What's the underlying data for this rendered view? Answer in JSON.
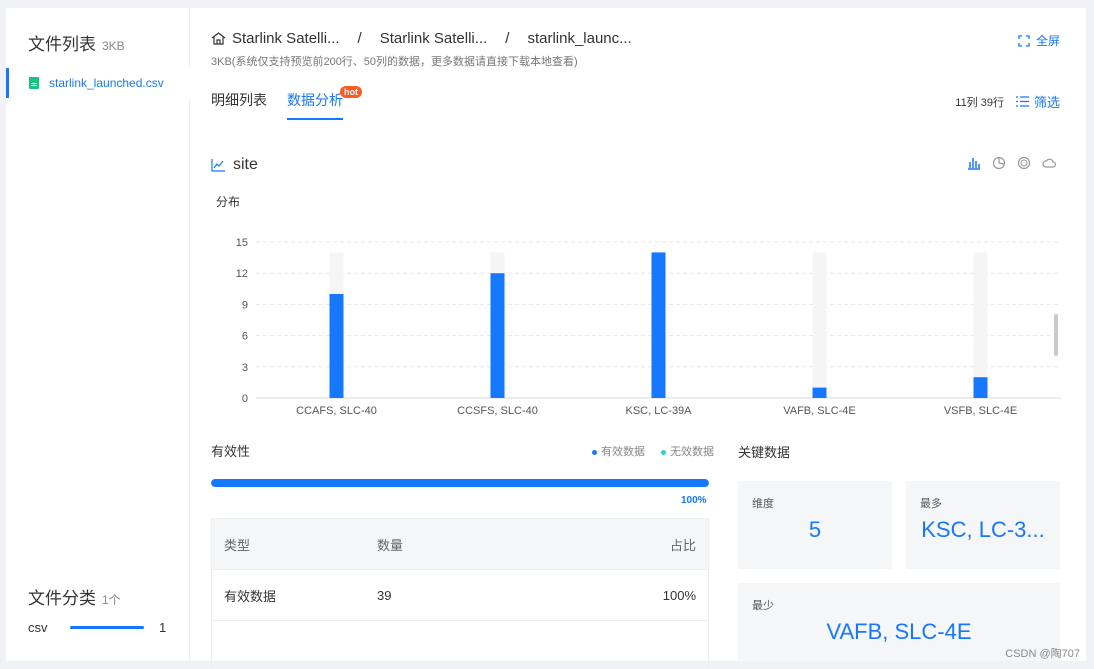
{
  "sidebar": {
    "title": "文件列表",
    "size": "3KB",
    "files": [
      {
        "name": "starlink_launched.csv"
      }
    ],
    "category_title": "文件分类",
    "category_count": "1个",
    "categories": [
      {
        "name": "csv",
        "count": "1"
      }
    ]
  },
  "header": {
    "breadcrumbs": [
      "Starlink Satelli...",
      "Starlink Satelli...",
      "starlink_launc..."
    ],
    "fullscreen_label": "全屏",
    "subinfo": "3KB(系统仅支持预览前200行、50列的数据，更多数据请直接下载本地查看)",
    "tabs": [
      {
        "label": "明细列表"
      },
      {
        "label": "数据分析",
        "badge": "hot"
      }
    ],
    "row_info": "11列 39行",
    "filter_label": "筛选"
  },
  "chart_section": {
    "title": "site",
    "dist_label": "分布"
  },
  "chart_data": {
    "type": "bar",
    "categories": [
      "CCAFS, SLC-40",
      "CCSFS, SLC-40",
      "KSC, LC-39A",
      "VAFB, SLC-4E",
      "VSFB, SLC-4E"
    ],
    "values": [
      10,
      12,
      14,
      1,
      2
    ],
    "background_values": [
      14,
      14,
      14,
      14,
      14
    ],
    "yticks": [
      0,
      3,
      6,
      9,
      12,
      15
    ],
    "ylim": [
      0,
      15
    ],
    "grid": true,
    "colors": {
      "bar": "#1677ff",
      "bar_bg": "#f5f5f5"
    }
  },
  "validity": {
    "title": "有效性",
    "legend": [
      {
        "label": "有效数据",
        "color": "#1677ff"
      },
      {
        "label": "无效数据",
        "color": "#36cfc9"
      }
    ],
    "valid_fraction": 1.0,
    "percent_label": "100%",
    "table": {
      "headers": [
        "类型",
        "数量",
        "占比"
      ],
      "rows": [
        [
          "有效数据",
          "39",
          "100%"
        ]
      ]
    }
  },
  "key_data": {
    "title": "关键数据",
    "cards": [
      {
        "label": "维度",
        "value": "5"
      },
      {
        "label": "最多",
        "value": "KSC, LC-3..."
      },
      {
        "label": "最少",
        "value": "VAFB, SLC-4E"
      }
    ]
  },
  "watermark": "CSDN @陶707"
}
